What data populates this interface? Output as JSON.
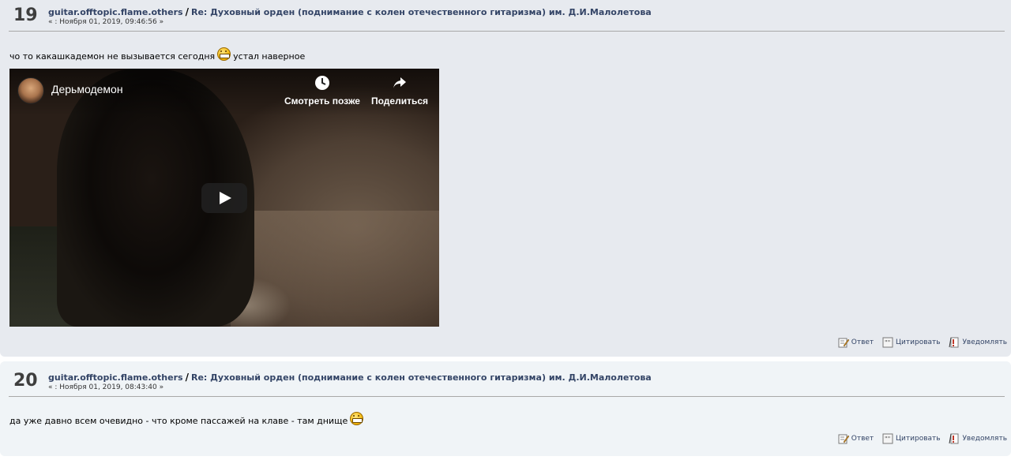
{
  "posts": [
    {
      "counter": "19",
      "board": "guitar.offtopic.flame.others",
      "separator": "/",
      "subject": "Re: Духовный орден (поднимание с колен отечественного гитаризма) им. Д.И.Малолетова",
      "date_prefix": "« :",
      "date": "Ноября 01, 2019, 09:46:56",
      "date_suffix": "»",
      "text_before_smiley": "чо то какашкадемон не вызывается сегодня",
      "text_after_smiley": "устал наверное",
      "video": {
        "title": "Дерьмодемон",
        "watch_later": "Смотреть позже",
        "share": "Поделиться"
      }
    },
    {
      "counter": "20",
      "board": "guitar.offtopic.flame.others",
      "separator": "/",
      "subject": "Re: Духовный орден (поднимание с колен отечественного гитаризма) им. Д.И.Малолетова",
      "date_prefix": "« :",
      "date": "Ноября 01, 2019, 08:43:40",
      "date_suffix": "»",
      "text_before_smiley": "да  уже давно всем очевидно - что кроме пассажей на клаве - там днище"
    }
  ],
  "buttons": {
    "reply": "Ответ",
    "quote": "Цитировать",
    "notify": "Уведомлять"
  },
  "icons": {
    "reply": "reply-icon",
    "quote": "quote-icon",
    "notify": "notify-icon",
    "smiley": "grin-smiley-icon",
    "watch_later": "clock-icon",
    "share": "share-arrow-icon",
    "play": "play-icon"
  },
  "colors": {
    "post_odd_bg": "#e7eaef",
    "post_even_bg": "#f0f4f7",
    "link": "#334466"
  }
}
